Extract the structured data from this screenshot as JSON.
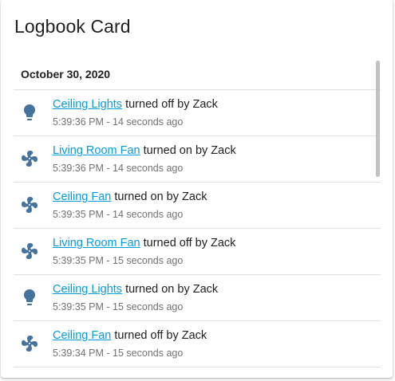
{
  "card": {
    "title": "Logbook Card",
    "date_header": "October 30, 2020"
  },
  "colors": {
    "icon": "#44739e",
    "link": "#039be5",
    "text": "#212121",
    "secondary": "#727272"
  },
  "entries": [
    {
      "icon": "lightbulb-icon",
      "entity": "Ceiling Lights",
      "action": "turned off by Zack",
      "time": "5:39:36 PM",
      "ago": "14 seconds ago"
    },
    {
      "icon": "fan-icon",
      "entity": "Living Room Fan",
      "action": "turned on by Zack",
      "time": "5:39:36 PM",
      "ago": "14 seconds ago"
    },
    {
      "icon": "fan-icon",
      "entity": "Ceiling Fan",
      "action": "turned on by Zack",
      "time": "5:39:35 PM",
      "ago": "14 seconds ago"
    },
    {
      "icon": "fan-icon",
      "entity": "Living Room Fan",
      "action": "turned off by Zack",
      "time": "5:39:35 PM",
      "ago": "15 seconds ago"
    },
    {
      "icon": "lightbulb-icon",
      "entity": "Ceiling Lights",
      "action": "turned on by Zack",
      "time": "5:39:35 PM",
      "ago": "15 seconds ago"
    },
    {
      "icon": "fan-icon",
      "entity": "Ceiling Fan",
      "action": "turned off by Zack",
      "time": "5:39:34 PM",
      "ago": "15 seconds ago"
    }
  ],
  "time_separator": " - "
}
